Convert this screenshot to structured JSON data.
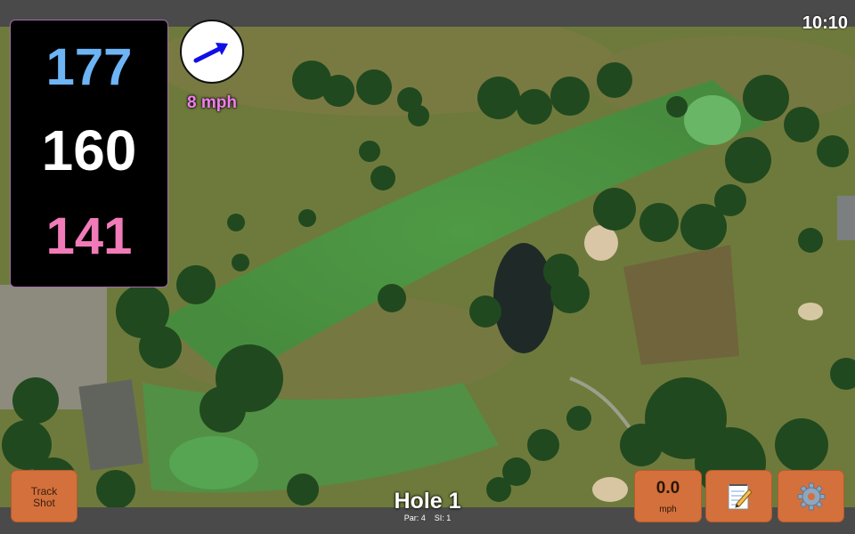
{
  "status_bar": {
    "time": "10:10"
  },
  "distances": {
    "back": "177",
    "middle": "160",
    "front": "141"
  },
  "wind": {
    "speed": "8 mph"
  },
  "buttons": {
    "track_shot_line1": "Track",
    "track_shot_line2": "Shot",
    "speed_value": "0.0",
    "speed_unit": "mph"
  },
  "hole": {
    "title": "Hole 1",
    "par": "Par: 4",
    "stroke_index": "SI: 1"
  },
  "icons": {
    "wind_arrow": "wind-direction-arrow-icon",
    "notes": "notepad-pencil-icon",
    "settings": "gear-icon"
  },
  "colors": {
    "back_distance": "#6db4f5",
    "middle_distance": "#ffffff",
    "front_distance": "#f07bb8",
    "wind_text": "#f27ef0",
    "button": "#d4703c"
  }
}
